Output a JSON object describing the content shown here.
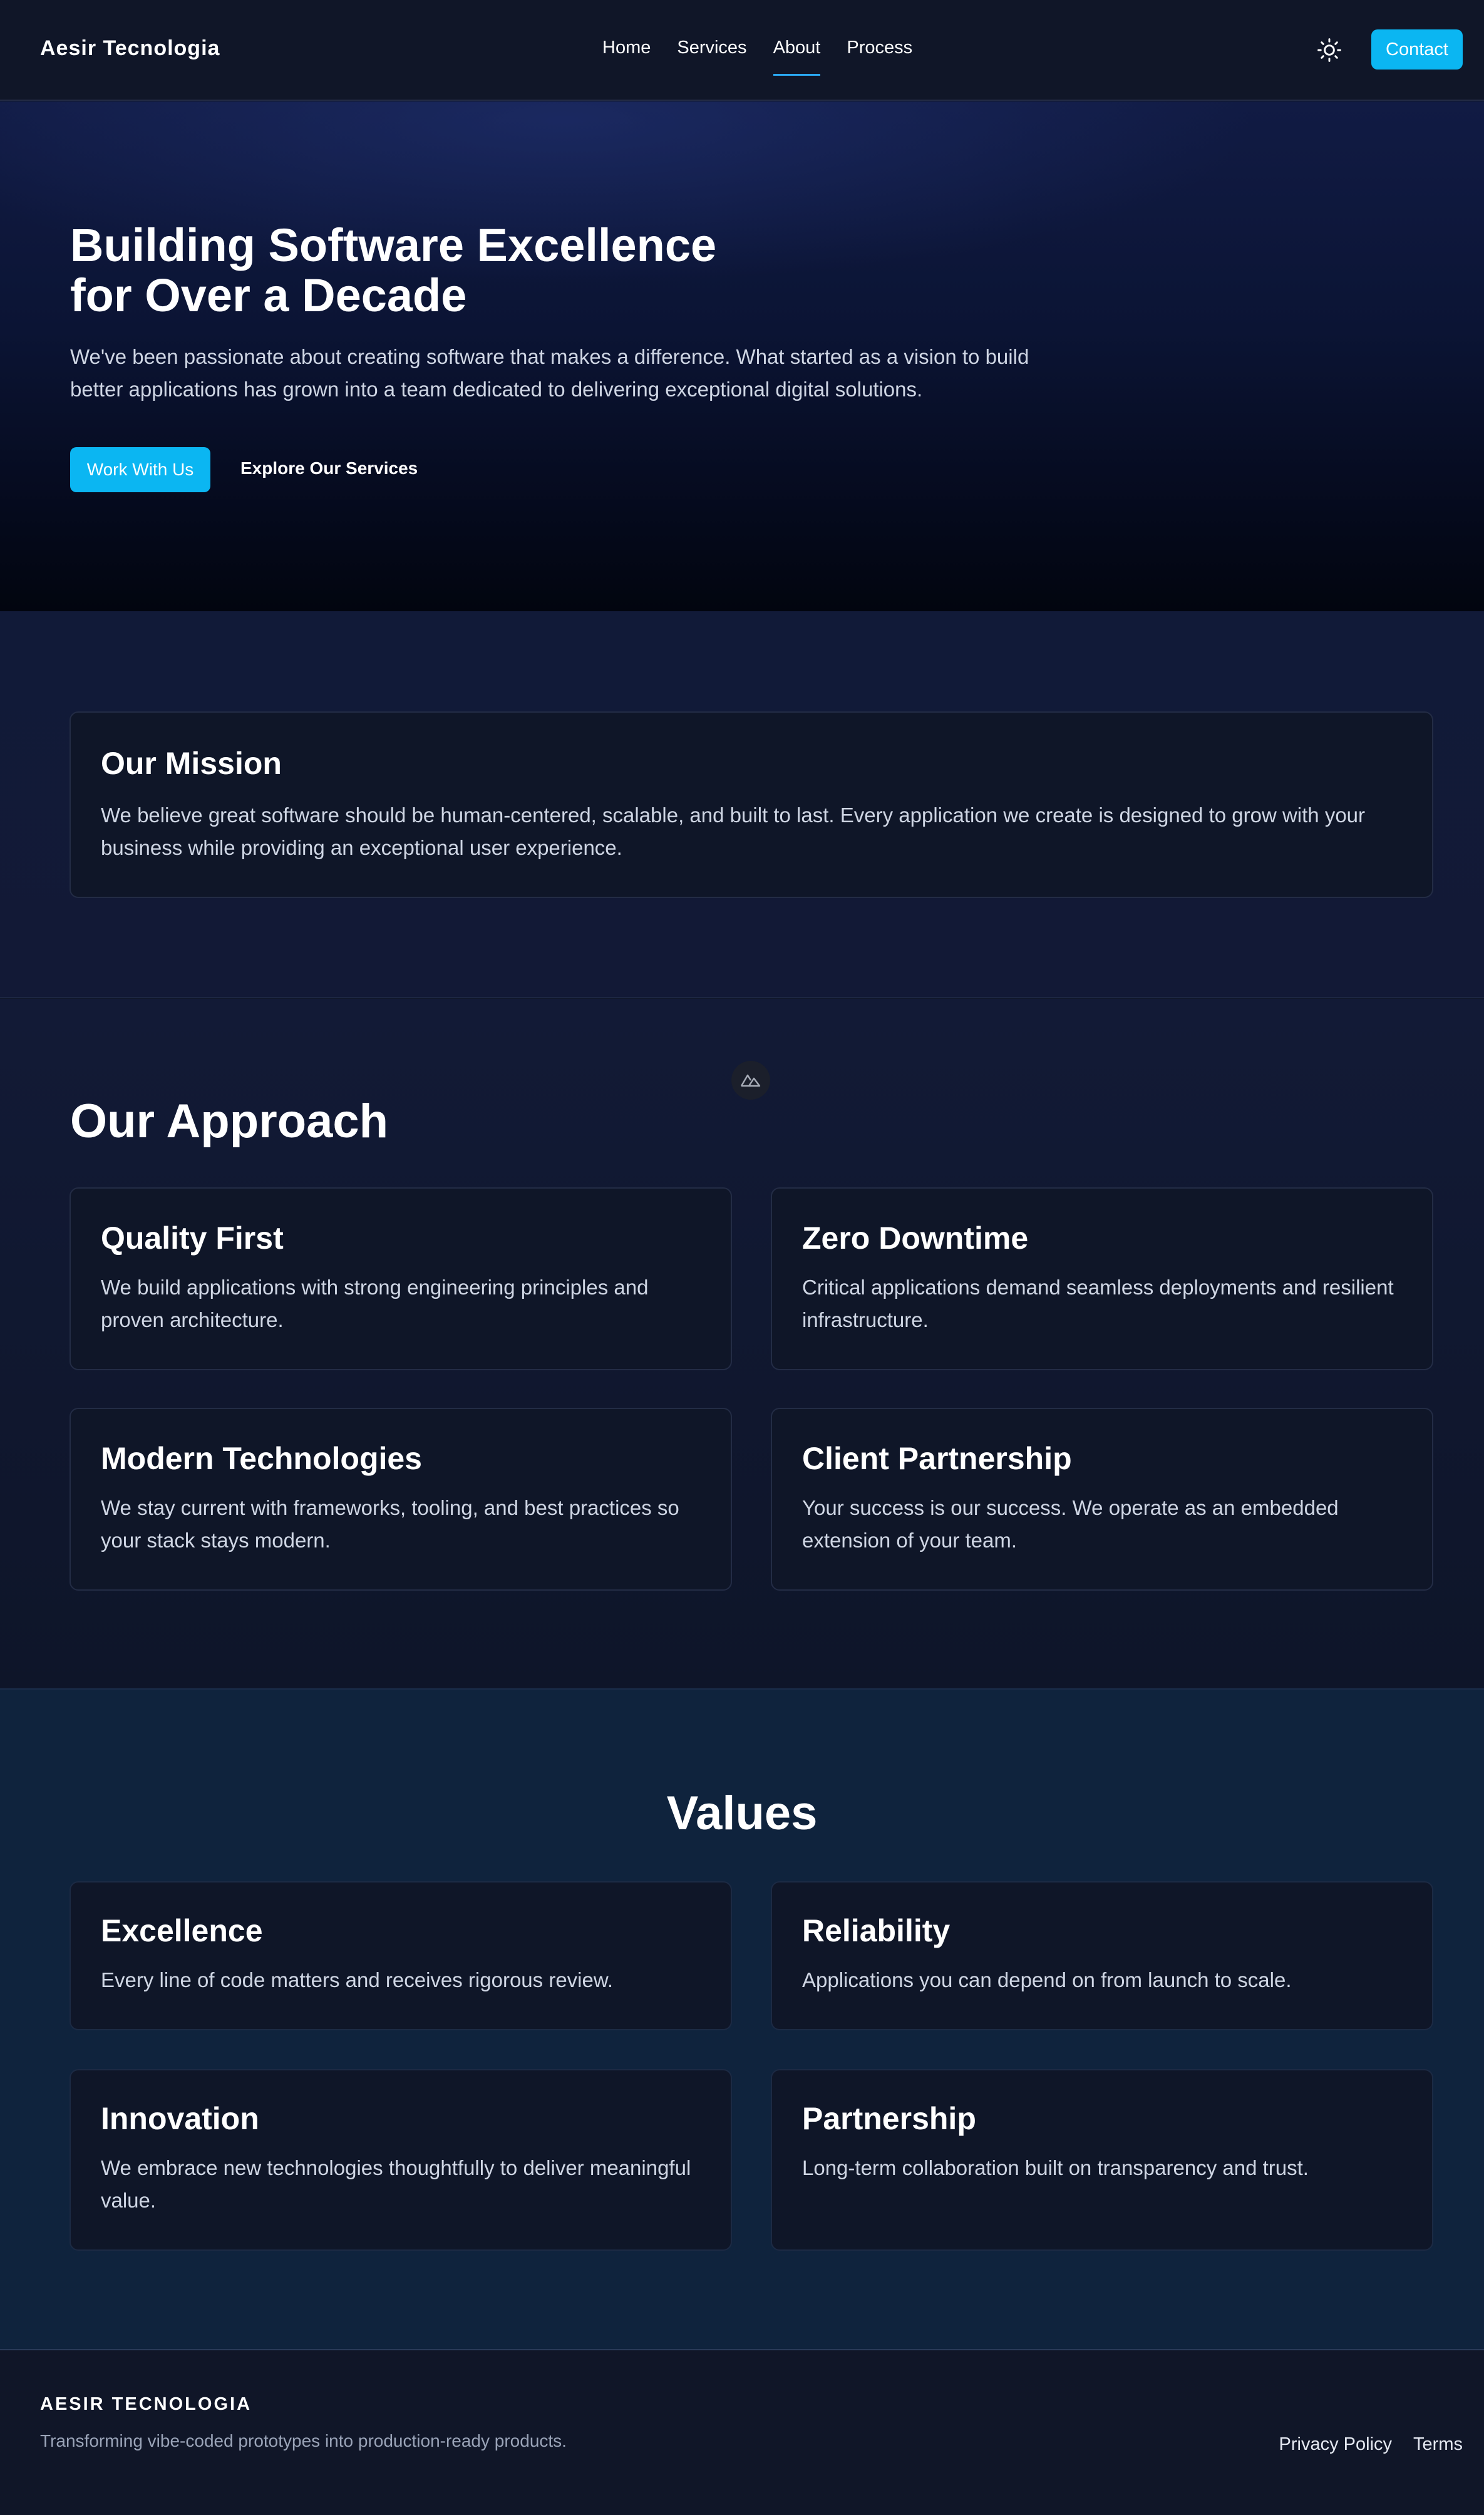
{
  "nav": {
    "brand": "Aesir Tecnologia",
    "links": [
      "Home",
      "Services",
      "About",
      "Process"
    ],
    "active_link": "About",
    "theme_icon": "sun-icon",
    "contact_label": "Contact"
  },
  "hero": {
    "title_line1": "Building Software Excellence",
    "title_line2": "for Over a Decade",
    "description": "We've been passionate about creating software that makes a difference. What started as a vision to build better applications has grown into a team dedicated to delivering exceptional digital solutions.",
    "primary_cta": "Work With Us",
    "secondary_cta": "Explore Our Services"
  },
  "mission": {
    "title": "Our Mission",
    "text": "We believe great software should be human-centered, scalable, and built to last. Every application we create is designed to grow with your business while providing an exceptional user experience."
  },
  "approach": {
    "badge_icon": "nuxt-logo-icon",
    "title": "Our Approach",
    "cards": [
      {
        "title": "Quality First",
        "text": "We build applications with strong engineering principles and proven architecture."
      },
      {
        "title": "Zero Downtime",
        "text": "Critical applications demand seamless deployments and resilient infrastructure."
      },
      {
        "title": "Modern Technologies",
        "text": "We stay current with frameworks, tooling, and best practices so your stack stays modern."
      },
      {
        "title": "Client Partnership",
        "text": "Your success is our success. We operate as an embedded extension of your team."
      }
    ]
  },
  "values": {
    "title": "Values",
    "cards": [
      {
        "title": "Excellence",
        "text": "Every line of code matters and receives rigorous review."
      },
      {
        "title": "Reliability",
        "text": "Applications you can depend on from launch to scale."
      },
      {
        "title": "Innovation",
        "text": "We embrace new technologies thoughtfully to deliver meaningful value."
      },
      {
        "title": "Partnership",
        "text": "Long-term collaboration built on transparency and trust."
      }
    ]
  },
  "footer": {
    "brand": "AESIR TECNOLOGIA",
    "tagline": "Transforming vibe-coded prototypes into production-ready products.",
    "links": [
      "Privacy Policy",
      "Terms"
    ]
  },
  "colors": {
    "accent": "#0bb6f2",
    "nav_underline": "#2aa8f2",
    "background": "#0f1629",
    "values_background": "#0f233d"
  }
}
